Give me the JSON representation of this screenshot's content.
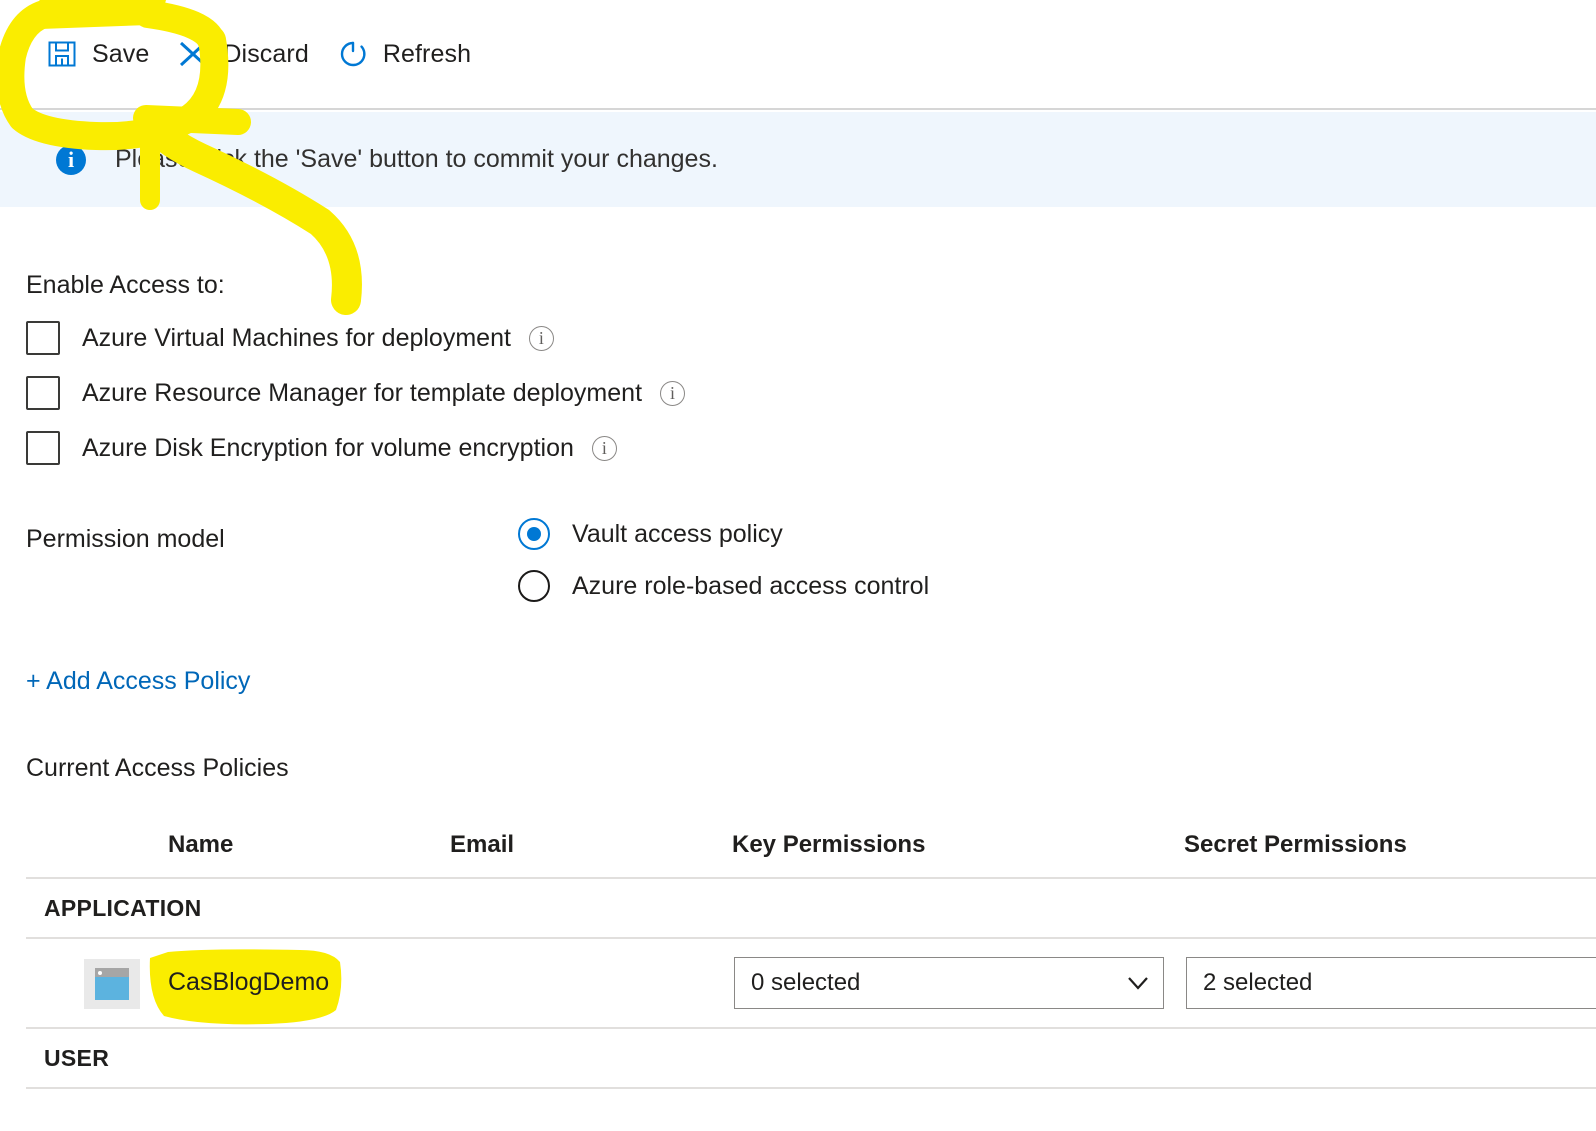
{
  "toolbar": {
    "buttons": [
      {
        "label": "Save",
        "icon": "save-floppy-icon"
      },
      {
        "label": "Discard",
        "icon": "close-x-icon"
      },
      {
        "label": "Refresh",
        "icon": "refresh-circular-arrow-icon"
      }
    ]
  },
  "banner": {
    "icon": "info-circle-icon",
    "message": "Please click the 'Save' button to commit your changes."
  },
  "enable_access": {
    "label": "Enable Access to:",
    "checkboxes": [
      {
        "label": "Azure Virtual Machines for deployment",
        "checked": false,
        "hint_icon": "info-outline-icon"
      },
      {
        "label": "Azure Resource Manager for template deployment",
        "checked": false,
        "hint_icon": "info-outline-icon"
      },
      {
        "label": "Azure Disk Encryption for volume encryption",
        "checked": false,
        "hint_icon": "info-outline-icon"
      }
    ]
  },
  "permission_model": {
    "label": "Permission model",
    "options": [
      {
        "label": "Vault access policy",
        "selected": true
      },
      {
        "label": "Azure role-based access control",
        "selected": false
      }
    ]
  },
  "add_access_policy_link": "+ Add Access Policy",
  "current_access_policies": {
    "heading": "Current Access Policies",
    "columns": [
      "Name",
      "Email",
      "Key Permissions",
      "Secret Permissions"
    ],
    "groups": [
      {
        "group_label": "APPLICATION",
        "rows": [
          {
            "icon": "application-window-icon",
            "name": "CasBlogDemo",
            "email": "",
            "key_permissions": "0 selected",
            "secret_permissions": "2 selected",
            "chevron": "chevron-down-icon"
          }
        ]
      },
      {
        "group_label": "USER",
        "rows": []
      }
    ]
  },
  "annotations": {
    "highlight_color": "#faed00",
    "items": [
      {
        "name": "save-button-circle-highlight",
        "shape": "rounded-rectangle-outline"
      },
      {
        "name": "pointer-arrow-highlight",
        "shape": "curved-arrow-pointing-up-left"
      },
      {
        "name": "casblogdemo-name-highlight",
        "shape": "filled-marker-blob"
      }
    ]
  },
  "colors": {
    "accent_blue": "#0078d4",
    "link_blue": "#0067b8",
    "banner_bg": "#eff6fd",
    "text": "#201f1e",
    "border": "#e1dfdd",
    "highlight_yellow": "#faed00"
  }
}
